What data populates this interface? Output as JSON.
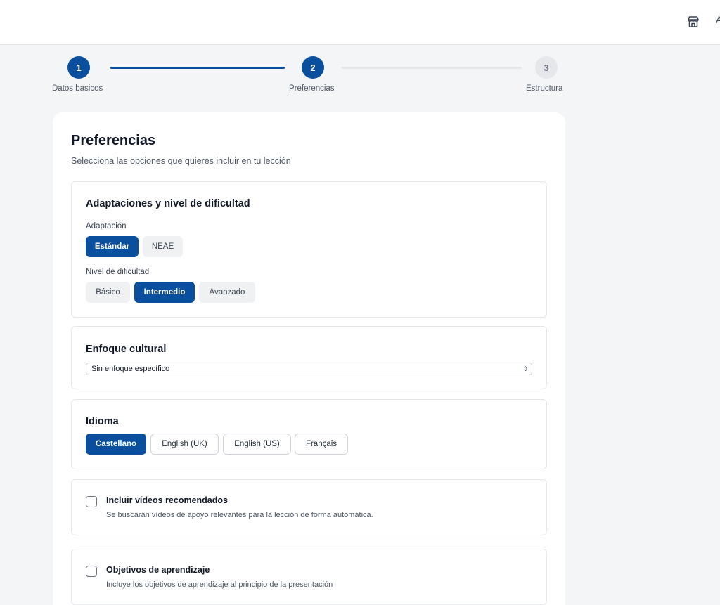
{
  "stepper": {
    "steps": [
      {
        "number": "1",
        "label": "Datos basicos",
        "state": "completed"
      },
      {
        "number": "2",
        "label": "Preferencias",
        "state": "current"
      },
      {
        "number": "3",
        "label": "Estructura",
        "state": "pending"
      }
    ]
  },
  "header": {
    "title": "Preferencias",
    "subtitle": "Selecciona las opciones que quieres incluir en tu lección"
  },
  "adaptaciones": {
    "title": "Adaptaciones y nivel de dificultad",
    "adaptacion_label": "Adaptación",
    "adaptacion_options": [
      "Estándar",
      "NEAE"
    ],
    "adaptacion_selected": "Estándar",
    "nivel_label": "Nivel de dificultad",
    "nivel_options": [
      "Básico",
      "Intermedio",
      "Avanzado"
    ],
    "nivel_selected": "Intermedio"
  },
  "enfoque": {
    "title": "Enfoque cultural",
    "selected_value": "Sin enfoque específico"
  },
  "idioma": {
    "title": "Idioma",
    "options": [
      "Castellano",
      "English (UK)",
      "English (US)",
      "Français"
    ],
    "selected": "Castellano"
  },
  "videos": {
    "title": "Incluir vídeos recomendados",
    "description": "Se buscarán vídeos de apoyo relevantes para la lección de forma automática.",
    "checked": false
  },
  "objetivos": {
    "title": "Objetivos de aprendizaje",
    "description": "Incluye los objetivos de aprendizaje al principio de la presentación",
    "checked": false
  },
  "icons": {
    "topbar_right": "store-icon",
    "select_chevron": "updown-chevron-icon"
  },
  "colors": {
    "accent": "#0a4f9e",
    "page_background": "#f4f5f7",
    "inactive_step": "#e5e7eb"
  }
}
